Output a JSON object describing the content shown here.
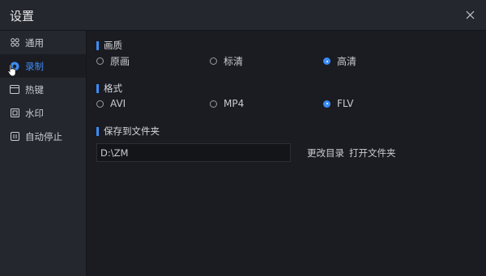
{
  "window": {
    "title": "设置"
  },
  "colors": {
    "accent": "#3b8cf5",
    "bg": "#1b1c22",
    "panel": "#25272e"
  },
  "sidebar": {
    "items": [
      {
        "label": "通用",
        "icon": "grid-icon",
        "active": false
      },
      {
        "label": "录制",
        "icon": "record-icon",
        "active": true
      },
      {
        "label": "热键",
        "icon": "keyboard-icon",
        "active": false
      },
      {
        "label": "水印",
        "icon": "watermark-icon",
        "active": false
      },
      {
        "label": "自动停止",
        "icon": "pause-icon",
        "active": false
      }
    ]
  },
  "main": {
    "quality": {
      "title": "画质",
      "options": [
        "原画",
        "标清",
        "高清"
      ],
      "selected": "高清"
    },
    "format": {
      "title": "格式",
      "options": [
        "AVI",
        "MP4",
        "FLV"
      ],
      "selected": "FLV"
    },
    "save": {
      "title": "保存到文件夹",
      "path": "D:\\ZM",
      "change_label": "更改目录",
      "open_label": "打开文件夹"
    }
  }
}
